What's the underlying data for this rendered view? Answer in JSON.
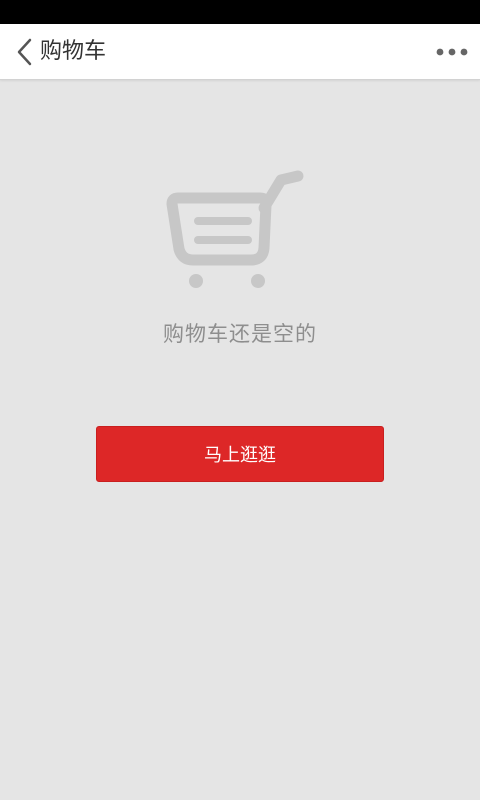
{
  "header": {
    "title": "购物车",
    "back_icon": "chevron-left-icon",
    "more_icon": "more-horizontal-icon"
  },
  "empty_state": {
    "icon": "shopping-cart-icon",
    "message": "购物车还是空的",
    "button_label": "马上逛逛"
  },
  "colors": {
    "status_bar": "#000000",
    "nav_background": "#ffffff",
    "page_background": "#e5e5e5",
    "accent": "#dd2727",
    "icon_gray": "#c7c7c7",
    "message_text": "#8e8e8e"
  }
}
